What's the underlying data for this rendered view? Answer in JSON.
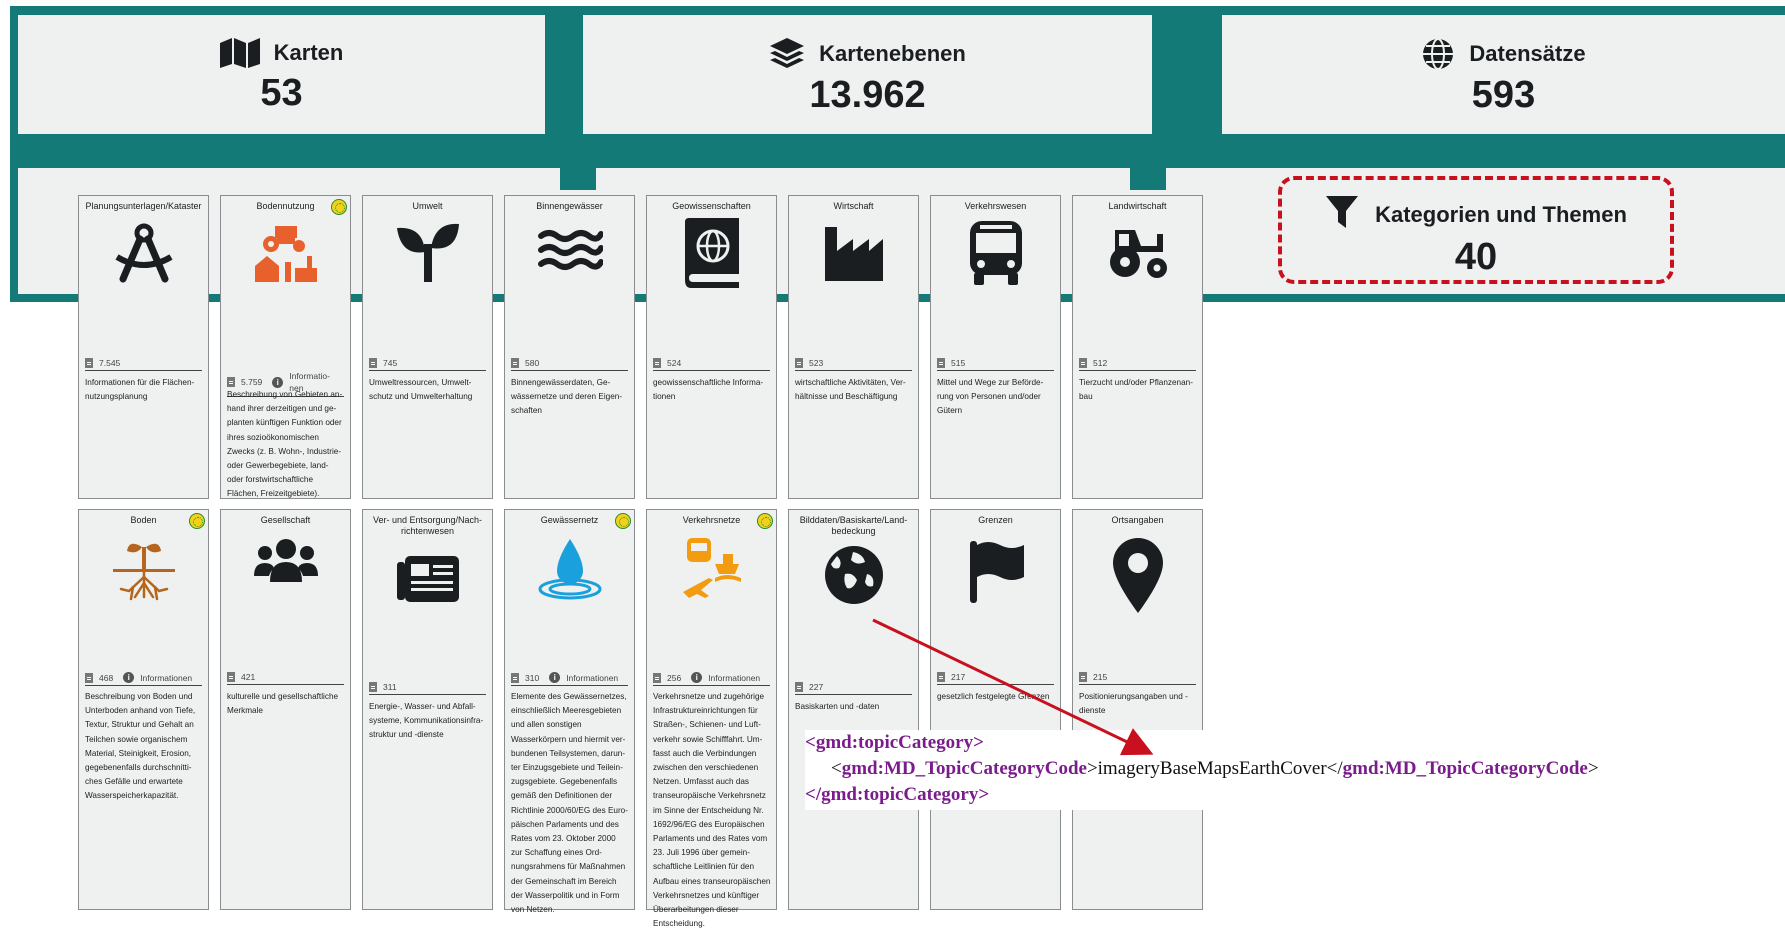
{
  "stats": [
    {
      "icon": "map-icon",
      "title": "Karten",
      "value": "53"
    },
    {
      "icon": "layers-icon",
      "title": "Kartenebenen",
      "value": "13.962"
    },
    {
      "icon": "globe-icon",
      "title": "Datensätze",
      "value": "593"
    }
  ],
  "categories_box": {
    "icon": "filter-icon",
    "title": "Kategorien und Themen",
    "value": "40"
  },
  "cards": [
    {
      "title": "Planungsunterlagen/Kataster",
      "icon": "compass-icon",
      "count": "7.545",
      "info": "",
      "desc": "Informationen für die Flächen­nutzungsplanung",
      "badge": false
    },
    {
      "title": "Bodennutzung",
      "icon": "land-use-icon",
      "count": "5.759",
      "info": "Informatio­nen",
      "desc": "Beschreibung von Gebieten an­hand ihrer derzeitigen und ge­planten künftigen Funktion oder ihres sozioökonomischen Zwecks (z. B. Wohn-, Industrie- oder Gewerbegebie­te, land- oder forstwirtschaftli­che Flächen, Freizeitgebiete).",
      "badge": true
    },
    {
      "title": "Umwelt",
      "icon": "seedling-icon",
      "count": "745",
      "info": "",
      "desc": "Umweltressourcen, Umwelt­schutz und Umwelterhaltung",
      "badge": false
    },
    {
      "title": "Binnengewässer",
      "icon": "water-icon",
      "count": "580",
      "info": "",
      "desc": "Binnengewässerdaten, Ge­wässernetze und deren Eigen­schaften",
      "badge": false
    },
    {
      "title": "Geowissenschaften",
      "icon": "atlas-icon",
      "count": "524",
      "info": "",
      "desc": "geowissenschaftliche Informa­tionen",
      "badge": false
    },
    {
      "title": "Wirtschaft",
      "icon": "industry-icon",
      "count": "523",
      "info": "",
      "desc": "wirtschaftliche Aktivitäten, Ver­hältnisse und Beschäftigung",
      "badge": false
    },
    {
      "title": "Verkehrswesen",
      "icon": "bus-icon",
      "count": "515",
      "info": "",
      "desc": "Mittel und Wege zur Beförde­rung von Personen und/oder Gütern",
      "badge": false
    },
    {
      "title": "Landwirtschaft",
      "icon": "tractor-icon",
      "count": "512",
      "info": "",
      "desc": "Tierzucht und/oder Pflanzenan­bau",
      "badge": false
    },
    {
      "title": "Boden",
      "icon": "soil-icon",
      "count": "468",
      "info": "Informationen",
      "desc": "Beschreibung von Boden und Unterboden anhand von Tiefe, Textur, Struktur und Gehalt an Teilchen sowie organischem Material, Steinigkeit, Erosion, gegebenenfalls durchschnitti­ches Gefälle und erwartete Wasserspeicherkapazität.",
      "badge": true
    },
    {
      "title": "Gesellschaft",
      "icon": "users-icon",
      "count": "421",
      "info": "",
      "desc": "kulturelle und gesellschaftliche Merkmale",
      "badge": false
    },
    {
      "title": "Ver- und Entsorgung/Nach­richtenwesen",
      "icon": "newspaper-icon",
      "count": "311",
      "info": "",
      "desc": "Energie-, Wasser- und Abfall­systeme, Kommunikationsinfra­struktur und -dienste",
      "badge": false
    },
    {
      "title": "Gewässernetz",
      "icon": "water-drop-icon",
      "count": "310",
      "info": "Informationen",
      "desc": "Elemente des Gewässernet­zes, einschließlich Meeresge­bieten und allen sonstigen Wasserkörpern und hiermit ver­bundenen Teilsystemen, darun­ter Einzugsgebiete und Teilein­zugsgebiete. Gegebenenfalls gemäß den Definitionen der Richtlinie 2000/60/EG des Euro­päischen Parlaments und des Rates vom 23. Oktober 2000 zur Schaffung eines Ord­nungsrahmens für Maßnahmen der Gemeinschaft im Bereich der Wasserpolitik und in Form von Netzen.",
      "badge": true
    },
    {
      "title": "Verkehrsnetze",
      "icon": "transport-networks-icon",
      "count": "256",
      "info": "Informationen",
      "desc": "Verkehrsnetze und zugehörige Infrastruktureinrichtungen für Straßen-, Schienen- und Luft­verkehr sowie Schifffahrt. Um­fasst auch die Verbindungen zwischen den verschiedenen Netzen. Umfasst auch das transeuropäische Verkehrsnetz im Sinne der Entscheidung Nr. 1692/96/EG des Europäischen Parlaments und des Rates vom 23. Juli 1996 über gemein­schaftliche Leitlinien für den Aufbau eines transeuropäi­schen Verkehrsnetzes und künftiger Überarbeitungen die­ser Entscheidung.",
      "badge": true
    },
    {
      "title": "Bilddaten/Basiskarte/Land­bedeckung",
      "icon": "earth-icon",
      "count": "227",
      "info": "",
      "desc": "Basiskarten und -daten",
      "badge": false
    },
    {
      "title": "Grenzen",
      "icon": "flag-icon",
      "count": "217",
      "info": "",
      "desc": "gesetzlich festgelegte Grenzen",
      "badge": false
    },
    {
      "title": "Ortsangaben",
      "icon": "map-marker-icon",
      "count": "215",
      "info": "",
      "desc": "Positionierungsangaben und -dienste",
      "badge": false
    }
  ],
  "xml_snippet": {
    "open_outer": "<gmd:topicCategory>",
    "open_inner_tag": "gmd:MD_TopicCategoryCode",
    "value": "imageryBaseMapsEarthCover",
    "close_inner_tag": "gmd:MD_TopicCategoryCode",
    "close_outer": "</gmd:topicCategory>"
  },
  "colors": {
    "teal": "#137a78",
    "highlight": "#c8101e",
    "xml_tag": "#7a1c8c",
    "icon_orange": "#e8602c"
  }
}
